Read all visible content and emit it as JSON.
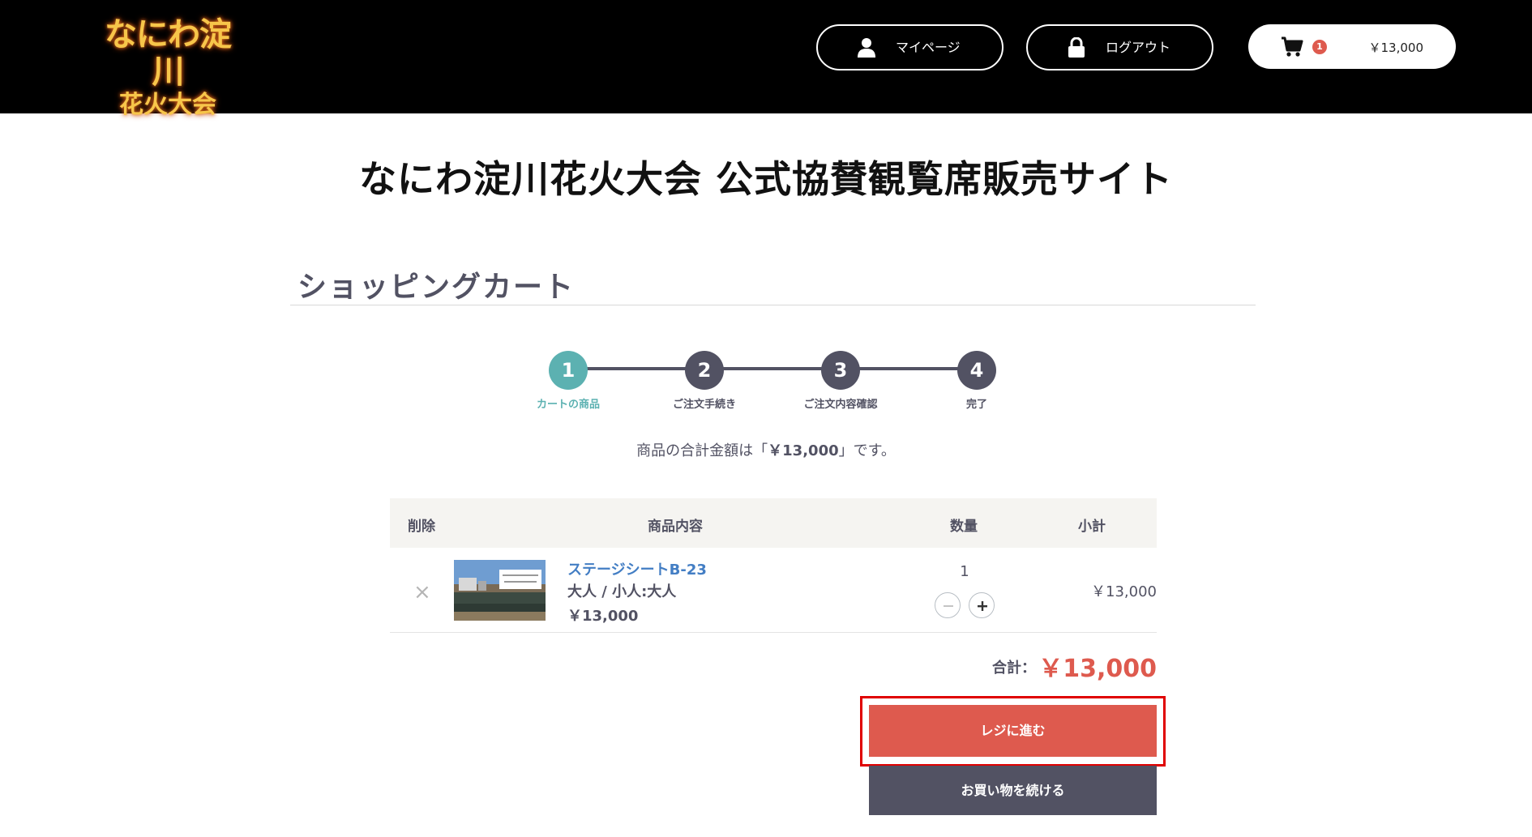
{
  "header": {
    "logo_line1": "なにわ淀川",
    "logo_line2": "花火大会",
    "mypage_label": "マイページ",
    "logout_label": "ログアウト",
    "cart_count": "1",
    "cart_amount": "￥13,000"
  },
  "site_title": "なにわ淀川花火大会 公式協賛観覧席販売サイト",
  "cart_heading": "ショッピングカート",
  "steps": [
    {
      "number": "1",
      "label": "カートの商品",
      "active": true
    },
    {
      "number": "2",
      "label": "ご注文手続き",
      "active": false
    },
    {
      "number": "3",
      "label": "ご注文内容確認",
      "active": false
    },
    {
      "number": "4",
      "label": "完了",
      "active": false
    }
  ],
  "total_message": {
    "prefix": "商品の合計金額は「",
    "amount": "￥13,000",
    "suffix": "」です。"
  },
  "table": {
    "headers": {
      "delete": "削除",
      "content": "商品内容",
      "quantity": "数量",
      "subtotal": "小計"
    },
    "rows": [
      {
        "delete_symbol": "×",
        "name": "ステージシートB-23",
        "option": "大人 / 小人:大人",
        "price": "￥13,000",
        "quantity": "1",
        "subtotal": "￥13,000"
      }
    ]
  },
  "grand_total": {
    "label": "合計：",
    "value": "￥13,000"
  },
  "buttons": {
    "checkout": "レジに進む",
    "continue": "お買い物を続ける"
  },
  "colors": {
    "accent_red": "#de5a4e",
    "step_active": "#5cb1b1",
    "dark_gray": "#525263",
    "link_blue": "#437ec4"
  }
}
